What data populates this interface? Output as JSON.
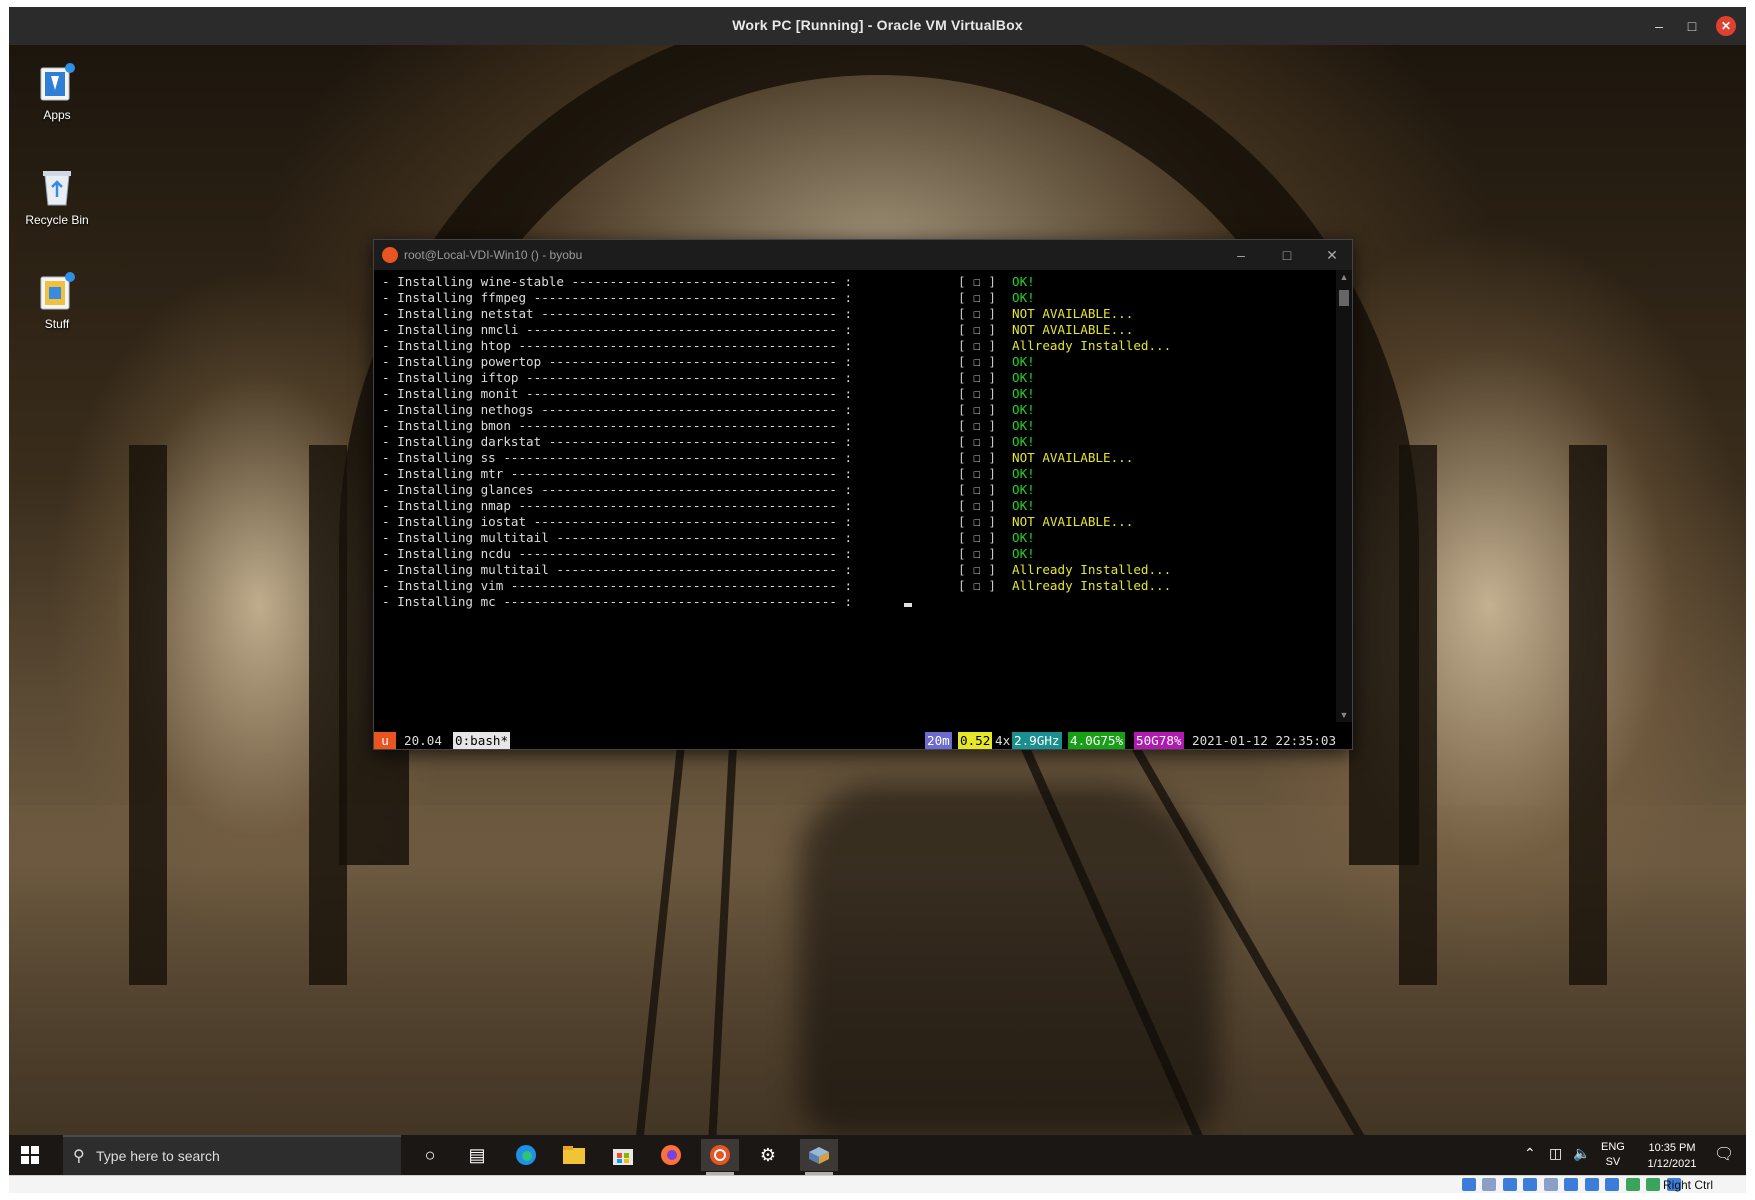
{
  "vbox": {
    "title": "Work PC [Running] - Oracle VM VirtualBox",
    "host_key": "Right Ctrl"
  },
  "desktop_icons": [
    {
      "label": "Apps",
      "icon": "apps-folder-icon"
    },
    {
      "label": "Recycle Bin",
      "icon": "recycle-bin-icon"
    },
    {
      "label": "Stuff",
      "icon": "stuff-folder-icon"
    }
  ],
  "terminal": {
    "title": "root@Local-VDI-Win10 () - byobu",
    "lines": [
      {
        "cmd": "- Installing wine-stable ----------------------------------- :",
        "box": "[ ☐ ]",
        "status": "OK!",
        "tone": "ok"
      },
      {
        "cmd": "- Installing ffmpeg ---------------------------------------- :",
        "box": "[ ☐ ]",
        "status": "OK!",
        "tone": "ok"
      },
      {
        "cmd": "- Installing netstat --------------------------------------- :",
        "box": "[ ☐ ]",
        "status": "NOT AVAILABLE...",
        "tone": "warn"
      },
      {
        "cmd": "- Installing nmcli ----------------------------------------- :",
        "box": "[ ☐ ]",
        "status": "NOT AVAILABLE...",
        "tone": "warn"
      },
      {
        "cmd": "- Installing htop ------------------------------------------ :",
        "box": "[ ☐ ]",
        "status": "Allready Installed...",
        "tone": "warn"
      },
      {
        "cmd": "- Installing powertop -------------------------------------- :",
        "box": "[ ☐ ]",
        "status": "OK!",
        "tone": "ok"
      },
      {
        "cmd": "- Installing iftop ----------------------------------------- :",
        "box": "[ ☐ ]",
        "status": "OK!",
        "tone": "ok"
      },
      {
        "cmd": "- Installing monit ----------------------------------------- :",
        "box": "[ ☐ ]",
        "status": "OK!",
        "tone": "ok"
      },
      {
        "cmd": "- Installing nethogs --------------------------------------- :",
        "box": "[ ☐ ]",
        "status": "OK!",
        "tone": "ok"
      },
      {
        "cmd": "- Installing bmon ------------------------------------------ :",
        "box": "[ ☐ ]",
        "status": "OK!",
        "tone": "ok"
      },
      {
        "cmd": "- Installing darkstat -------------------------------------- :",
        "box": "[ ☐ ]",
        "status": "OK!",
        "tone": "ok"
      },
      {
        "cmd": "- Installing ss -------------------------------------------- :",
        "box": "[ ☐ ]",
        "status": "NOT AVAILABLE...",
        "tone": "warn"
      },
      {
        "cmd": "- Installing mtr ------------------------------------------- :",
        "box": "[ ☐ ]",
        "status": "OK!",
        "tone": "ok"
      },
      {
        "cmd": "- Installing glances --------------------------------------- :",
        "box": "[ ☐ ]",
        "status": "OK!",
        "tone": "ok"
      },
      {
        "cmd": "- Installing nmap ------------------------------------------ :",
        "box": "[ ☐ ]",
        "status": "OK!",
        "tone": "ok"
      },
      {
        "cmd": "- Installing iostat ---------------------------------------- :",
        "box": "[ ☐ ]",
        "status": "NOT AVAILABLE...",
        "tone": "warn"
      },
      {
        "cmd": "- Installing multitail ------------------------------------- :",
        "box": "[ ☐ ]",
        "status": "OK!",
        "tone": "ok"
      },
      {
        "cmd": "- Installing ncdu ------------------------------------------ :",
        "box": "[ ☐ ]",
        "status": "OK!",
        "tone": "ok"
      },
      {
        "cmd": "- Installing multitail ------------------------------------- :",
        "box": "[ ☐ ]",
        "status": "Allready Installed...",
        "tone": "warn"
      },
      {
        "cmd": "- Installing vim ------------------------------------------- :",
        "box": "[ ☐ ]",
        "status": "Allready Installed...",
        "tone": "warn"
      },
      {
        "cmd": "- Installing mc -------------------------------------------- :",
        "box": "",
        "status": "",
        "tone": "ok"
      }
    ],
    "statusbar": {
      "logo": "u",
      "release": "20.04",
      "window": "0:bash*",
      "uptime": "20m",
      "load": "0.52",
      "cpu_count": "4x",
      "cpu_freq": "2.9GHz",
      "mem": "4.0G75%",
      "disk": "50G78%",
      "datetime": "2021-01-12 22:35:03"
    }
  },
  "taskbar": {
    "search_placeholder": "Type here to search",
    "apps": [
      "cortana-icon",
      "task-view-icon",
      "edge-icon",
      "file-explorer-icon",
      "store-icon",
      "firefox-icon",
      "ubuntu-icon",
      "settings-icon",
      "virtualbox-icon"
    ],
    "lang_top": "ENG",
    "lang_bottom": "SV",
    "time": "10:35 PM",
    "date": "1/12/2021"
  },
  "colors": {
    "ok": "#22d422",
    "warn": "#e6e62a",
    "ubuntu_orange": "#e95420"
  }
}
